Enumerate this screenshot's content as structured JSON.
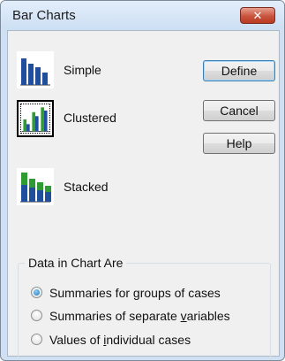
{
  "window": {
    "title": "Bar Charts",
    "close_glyph": "✕"
  },
  "chart_types": [
    {
      "label": "Simple",
      "icon": "simple-bar-chart-icon",
      "selected": false
    },
    {
      "label": "Clustered",
      "icon": "clustered-bar-chart-icon",
      "selected": true
    },
    {
      "label": "Stacked",
      "icon": "stacked-bar-chart-icon",
      "selected": false
    }
  ],
  "buttons": {
    "define": "Define",
    "cancel": "Cancel",
    "help": "Help"
  },
  "data_group": {
    "title": "Data in Chart Are",
    "options": [
      {
        "pre": "Summaries for ",
        "key": "g",
        "post": "roups of cases",
        "selected": true
      },
      {
        "pre": "Summaries of separate ",
        "key": "v",
        "post": "ariables",
        "selected": false
      },
      {
        "pre": "Values of ",
        "key": "i",
        "post": "ndividual cases",
        "selected": false
      }
    ]
  },
  "colors": {
    "bar_blue": "#1f4e9c",
    "bar_green": "#2e9b33",
    "title_bg": "#d7e6f7",
    "close_red": "#c8543e"
  }
}
